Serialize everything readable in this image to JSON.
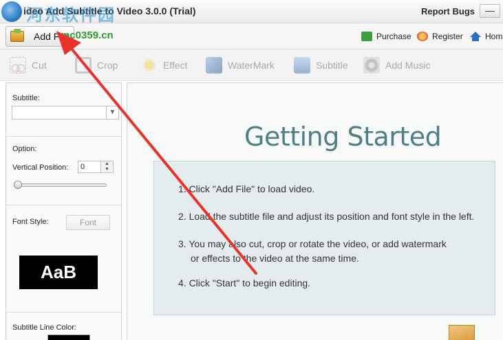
{
  "window": {
    "title": "ideo Add Subtitle to Video 3.0.0 (Trial)",
    "watermark_cn": "河东软件园",
    "watermark_url": ".pc0359.cn",
    "report_bugs": "Report Bugs",
    "minimize": "—"
  },
  "topbar": {
    "add_file": "Add File",
    "links": {
      "purchase": "Purchase",
      "register": "Register",
      "home": "Home"
    }
  },
  "toolbar": {
    "cut": "Cut",
    "crop": "Crop",
    "effect": "Effect",
    "watermark": "WaterMark",
    "subtitle": "Subtitle",
    "add_music": "Add Music"
  },
  "left_panel": {
    "subtitle_label": "Subtitle:",
    "subtitle_value": "",
    "option_label": "Option:",
    "vertical_position_label": "Vertical Position:",
    "vertical_position_value": "0",
    "font_style_label": "Font Style:",
    "font_button": "Font",
    "font_preview": "AaB",
    "subtitle_line_color_label": "Subtitle Line Color:",
    "subtitle_line_color": "#000000"
  },
  "main": {
    "heading": "Getting Started",
    "steps": [
      "1. Click \"Add File\" to load video.",
      "2. Load the subtitle file and adjust its position and font style in the left.",
      "3. You may also cut, crop or rotate the video, or add watermark",
      "or effects to the video at the same time.",
      "4. Click \"Start\" to begin editing."
    ]
  },
  "colors": {
    "accent_arrow": "#e8322a",
    "heading": "#4f7f86",
    "info_box": "#e4ecee"
  }
}
